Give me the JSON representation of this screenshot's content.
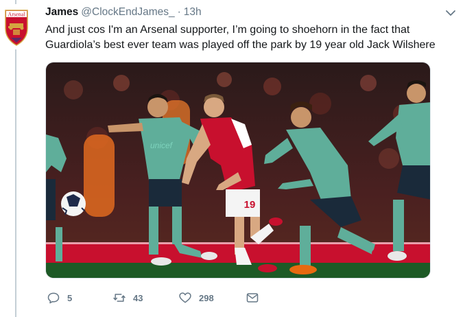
{
  "tweet": {
    "author_name": "James",
    "handle": "@ClockEndJames_",
    "separator": "·",
    "time": "13h",
    "text": "And just cos I'm an Arsenal supporter, I’m going to shoehorn in the fact that Guardiola’s best ever team was played off the park by 19 year old Jack Wilshere",
    "avatar_icon": "arsenal-crest-icon",
    "crest_text": "Arsenal",
    "media": {
      "kind": "photo",
      "jersey_number": "19",
      "sponsor_text": "unicef"
    }
  },
  "actions": {
    "reply_count": "5",
    "retweet_count": "43",
    "like_count": "298",
    "reply_icon": "reply-icon",
    "retweet_icon": "retweet-icon",
    "like_icon": "heart-icon",
    "dm_icon": "envelope-icon"
  },
  "colors": {
    "text": "#14171a",
    "secondary": "#657786",
    "icon": "#657786",
    "arsenal_red": "#c8102e",
    "barca_teal": "#5fae9a",
    "pitch": "#1d5a26"
  }
}
